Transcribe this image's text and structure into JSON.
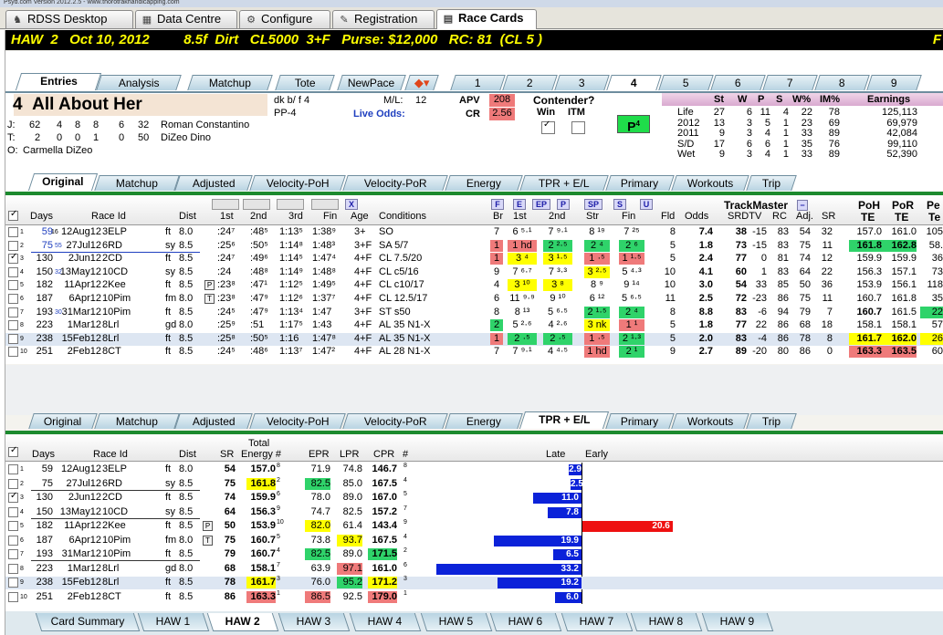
{
  "window": {
    "title_fragment": "Psyd.com   Version 2012.2.5   -   www.thorotrakhandicapping.com"
  },
  "app_tabs": [
    {
      "label": "RDSS Desktop",
      "icon": "horse-icon"
    },
    {
      "label": "Data Centre",
      "icon": "folder-icon"
    },
    {
      "label": "Configure",
      "icon": "gear-icon"
    },
    {
      "label": "Registration",
      "icon": "registration-icon"
    },
    {
      "label": "Race Cards",
      "icon": "racecard-icon"
    }
  ],
  "race_header": {
    "text": "HAW  2   Oct 10, 2012         8.5f  Dirt   CL5000  3+F   Purse: $12,000   RC: 81  (CL 5 )",
    "right": "F"
  },
  "horse_tabs": [
    "Entries",
    "Analysis",
    "Matchup",
    "Tote",
    "NewPace"
  ],
  "post_tabs": [
    "1",
    "2",
    "3",
    "4",
    "5",
    "6",
    "7",
    "8",
    "9"
  ],
  "horse": {
    "post": "4",
    "name": "All About Her",
    "color": "dk b/ f 4",
    "pp": "PP-4",
    "ml_label": "M/L:",
    "ml": "12",
    "live_odds_label": "Live Odds:",
    "apv_label": "APV",
    "apv": "208",
    "cr_label": "CR",
    "cr": "2.56",
    "contender_label": "Contender?",
    "win_label": "Win",
    "itm_label": "ITM",
    "p_badge": "P",
    "p_sup": "4",
    "jockey": {
      "label": "J:",
      "stats": [
        "62",
        "4",
        "8",
        "8",
        "6",
        "32"
      ],
      "name": "Roman Constantino"
    },
    "trainer": {
      "label": "T:",
      "stats": [
        "2",
        "0",
        "0",
        "1",
        "0",
        "50"
      ],
      "name": "DiZeo Dino"
    },
    "owner": {
      "label": "O:",
      "name": "Carmella DiZeo"
    }
  },
  "record": {
    "headers": [
      "St",
      "W",
      "P",
      "S",
      "W%",
      "IM%",
      "Earnings"
    ],
    "rows": [
      {
        "label": "Life",
        "v": [
          "27",
          "6",
          "11",
          "4",
          "22",
          "78",
          "125,113"
        ]
      },
      {
        "label": "2012",
        "v": [
          "13",
          "3",
          "5",
          "1",
          "23",
          "69",
          "69,979"
        ]
      },
      {
        "label": "2011",
        "v": [
          "9",
          "3",
          "4",
          "1",
          "33",
          "89",
          "42,084"
        ]
      },
      {
        "label": "S/D",
        "v": [
          "17",
          "6",
          "6",
          "1",
          "35",
          "76",
          "99,110"
        ]
      },
      {
        "label": "Wet",
        "v": [
          "9",
          "3",
          "4",
          "1",
          "33",
          "89",
          "52,390"
        ]
      }
    ]
  },
  "view_tabs": [
    "Original",
    "Matchup",
    "Adjusted",
    "Velocity-PoH",
    "Velocity-PoR",
    "Energy",
    "TPR + E/L",
    "Primary",
    "Workouts",
    "Trip"
  ],
  "upper_grid": {
    "headers": {
      "days": "Days",
      "raceid": "Race Id",
      "dist": "Dist",
      "c1": "1st",
      "c2": "2nd",
      "c3": "3rd",
      "fin": "Fin",
      "age": "Age",
      "cond": "Conditions",
      "br": "Br",
      "f1": "1st",
      "f2": "2nd",
      "str": "Str",
      "ffin": "Fin",
      "fld": "Fld",
      "odds": "Odds",
      "tm": "TrackMaster",
      "srdtv": "SRDTV",
      "rc": "RC",
      "adj": "Adj.",
      "sr": "SR",
      "poh": "PoH",
      "por": "PoR",
      "pe": "Pe",
      "te": "TE",
      "te2": "TE",
      "te3": "Te"
    },
    "buttons": [
      "F",
      "E",
      "EP",
      "P",
      "SP",
      "S",
      "U",
      "X"
    ],
    "rows": [
      {
        "n": "1",
        "days": "59",
        "dsup": "16",
        "date": "12Aug12",
        "race": "3ELP",
        "track": "ft",
        "dist": "8.0",
        "c1": ":24⁷",
        ":c2": "",
        "c2": ":48⁵",
        "c3": "1:13⁵",
        "fin": "1:38⁹",
        "age": "3+",
        "cond": "SO",
        "br": "7",
        "f1": "6 ⁵·¹",
        "f2": "7 ⁹·¹",
        "str": "8 ¹⁹",
        "ffin": "7 ²⁵",
        "fld": "8",
        "odds": "7.4",
        "srd": "38",
        "tv": "-15",
        "rc": "83",
        "adj": "54",
        "sr": "32",
        "te": "157.0",
        "te2": "161.0",
        "te3": "105"
      },
      {
        "n": "2",
        "days": "75",
        "dsup": "55",
        "date": "27Jul12",
        "race": "6RD",
        "track": "sy",
        "dist": "8.5",
        "c1": ":25⁶",
        "c2": ":50⁵",
        "c3": "1:14⁸",
        "fin": "1:48³",
        "age": "3+F",
        "cond": "SA 5/7",
        "br": "1",
        "f1": "1 hd",
        "f2": "2 ²·⁵",
        "str": "2 ⁴",
        "ffin": "2 ⁶",
        "fld": "5",
        "odds": "1.8",
        "srd": "73",
        "tv": "-15",
        "rc": "83",
        "adj": "75",
        "sr": "11",
        "te": "161.8",
        "te2": "162.8",
        "te3": "58."
      },
      {
        "n": "3",
        "days": "130",
        "dsup": "",
        "date": "2Jun12",
        "race": "2CD",
        "track": "ft",
        "dist": "8.5",
        "c1": ":24⁷",
        "c2": ":49⁶",
        "c3": "1:14⁵",
        "fin": "1:47⁴",
        "age": "4+F",
        "cond": "CL 7.5/20",
        "br": "1",
        "f1": "3 ⁴",
        "f2": "3 ¹·⁵",
        "str": "1 ·⁵",
        "ffin": "1 ¹·⁵",
        "fld": "5",
        "odds": "2.4",
        "srd": "77",
        "tv": "0",
        "rc": "81",
        "adj": "74",
        "sr": "12",
        "te": "159.9",
        "te2": "159.9",
        "te3": "36"
      },
      {
        "n": "4",
        "days": "150",
        "dsup": "32",
        "date": "13May12",
        "race": "10CD",
        "track": "sy",
        "dist": "8.5",
        "c1": ":24",
        "c2": ":48⁸",
        "c3": "1:14⁹",
        "fin": "1:48⁸",
        "age": "4+F",
        "cond": "CL c5/16",
        "br": "9",
        "f1": "7 ⁶·⁷",
        "f2": "7 ³·³",
        "str": "3 ²·⁵",
        "ffin": "5 ⁴·³",
        "fld": "10",
        "odds": "4.1",
        "srd": "60",
        "tv": "1",
        "rc": "83",
        "adj": "64",
        "sr": "22",
        "te": "156.3",
        "te2": "157.1",
        "te3": "73"
      },
      {
        "n": "5",
        "days": "182",
        "dsup": "",
        "date": "11Apr12",
        "race": "2Kee",
        "track": "ft",
        "dist": "8.5",
        "c1": ":23⁸",
        "c2": ":47¹",
        "c3": "1:12⁵",
        "fin": "1:49⁵",
        "age": "4+F",
        "cond": "CL c10/17",
        "br": "4",
        "f1": "3 ¹⁰",
        "f2": "3 ⁸",
        "str": "8 ⁹",
        "ffin": "9 ¹⁴",
        "fld": "10",
        "odds": "3.0",
        "srd": "54",
        "tv": "33",
        "rc": "85",
        "adj": "50",
        "sr": "36",
        "te": "153.9",
        "te2": "156.1",
        "te3": "118"
      },
      {
        "n": "6",
        "days": "187",
        "dsup": "",
        "date": "6Apr12",
        "race": "10Pim",
        "track": "fm",
        "dist": "8.0",
        "c1": ":23⁸",
        "c2": ":47⁹",
        "c3": "1:12⁶",
        "fin": "1:37⁷",
        "age": "4+F",
        "cond": "CL 12.5/17",
        "br": "6",
        "f1": "11 ⁹·⁹",
        "f2": "9 ¹⁰",
        "str": "6 ¹²",
        "ffin": "5 ⁶·⁵",
        "fld": "11",
        "odds": "2.5",
        "srd": "72",
        "tv": "-23",
        "rc": "86",
        "adj": "75",
        "sr": "11",
        "te": "160.7",
        "te2": "161.8",
        "te3": "35"
      },
      {
        "n": "7",
        "days": "193",
        "dsup": "30",
        "date": "31Mar12",
        "race": "10Pim",
        "track": "ft",
        "dist": "8.5",
        "c1": ":24⁵",
        "c2": ":47⁹",
        "c3": "1:13⁴",
        "fin": "1:47",
        "age": "3+F",
        "cond": "ST s50",
        "br": "8",
        "f1": "8 ¹³",
        "f2": "5 ⁶·⁵",
        "str": "2 ¹·⁵",
        "ffin": "2 ⁴",
        "fld": "8",
        "odds": "8.8",
        "srd": "83",
        "tv": "-6",
        "rc": "94",
        "adj": "79",
        "sr": "7",
        "te": "160.7",
        "te2": "161.5",
        "te3": "22"
      },
      {
        "n": "8",
        "days": "223",
        "dsup": "",
        "date": "1Mar12",
        "race": "8Lrl",
        "track": "gd",
        "dist": "8.0",
        "c1": ":25⁹",
        "c2": ":51",
        "c3": "1:17⁵",
        "fin": "1:43",
        "age": "4+F",
        "cond": "AL 35 N1-X",
        "br": "2",
        "f1": "5 ²·⁶",
        "f2": "4 ²·⁶",
        "str": "3 nk",
        "ffin": "1 ¹",
        "fld": "5",
        "odds": "1.8",
        "srd": "77",
        "tv": "22",
        "rc": "86",
        "adj": "68",
        "sr": "18",
        "te": "158.1",
        "te2": "158.1",
        "te3": "57"
      },
      {
        "n": "9",
        "days": "238",
        "dsup": "",
        "date": "15Feb12",
        "race": "8Lrl",
        "track": "ft",
        "dist": "8.5",
        "c1": ":25⁸",
        "c2": ":50⁵",
        "c3": "1:16",
        "fin": "1:47⁸",
        "age": "4+F",
        "cond": "AL 35 N1-X",
        "br": "1",
        "f1": "2 ·⁵",
        "f2": "2 ·⁵",
        "str": "1 ·⁵",
        "ffin": "2 ¹·³",
        "fld": "5",
        "odds": "2.0",
        "srd": "83",
        "tv": "-4",
        "rc": "86",
        "adj": "78",
        "sr": "8",
        "te": "161.7",
        "te2": "162.0",
        "te3": "26"
      },
      {
        "n": "10",
        "days": "251",
        "dsup": "",
        "date": "2Feb12",
        "race": "8CT",
        "track": "ft",
        "dist": "8.5",
        "c1": ":24⁵",
        "c2": ":48⁶",
        "c3": "1:13⁷",
        "fin": "1:47²",
        "age": "4+F",
        "cond": "AL 28 N1-X",
        "br": "7",
        "f1": "7 ⁹·¹",
        "f2": "4 ⁴·⁵",
        "str": "1 hd",
        "ffin": "2 ¹",
        "fld": "9",
        "odds": "2.7",
        "srd": "89",
        "tv": "-20",
        "rc": "80",
        "adj": "86",
        "sr": "0",
        "te": "163.3",
        "te2": "163.5",
        "te3": "60"
      }
    ]
  },
  "lower_grid": {
    "headers": {
      "days": "Days",
      "raceid": "Race Id",
      "dist": "Dist",
      "sr": "SR",
      "total": "Total",
      "energy": "Energy #",
      "epr": "EPR",
      "lpr": "LPR",
      "cpr": "CPR",
      "hash": "#",
      "late": "Late",
      "early": "Early"
    },
    "rows": [
      {
        "n": "1",
        "days": "59",
        "date": "12Aug12",
        "race": "3ELP",
        "track": "ft",
        "dist": "8.0",
        "sr": "54",
        "energy": "157.0",
        "erank": "8",
        "epr": "71.9",
        "lpr": "74.8",
        "cpr": "146.7",
        "crank": "8",
        "late": 2.9,
        "early": 0
      },
      {
        "n": "2",
        "days": "75",
        "date": "27Jul12",
        "race": "6RD",
        "track": "sy",
        "dist": "8.5",
        "sr": "75",
        "energy": "161.8",
        "erank": "2",
        "epr": "82.5",
        "lpr": "85.0",
        "cpr": "167.5",
        "crank": "4",
        "late": 2.5,
        "early": 0
      },
      {
        "n": "3",
        "days": "130",
        "date": "2Jun12",
        "race": "2CD",
        "track": "ft",
        "dist": "8.5",
        "sr": "74",
        "energy": "159.9",
        "erank": "6",
        "epr": "78.0",
        "lpr": "89.0",
        "cpr": "167.0",
        "crank": "5",
        "late": 11.0,
        "early": 0
      },
      {
        "n": "4",
        "days": "150",
        "date": "13May12",
        "race": "10CD",
        "track": "sy",
        "dist": "8.5",
        "sr": "64",
        "energy": "156.3",
        "erank": "9",
        "epr": "74.7",
        "lpr": "82.5",
        "cpr": "157.2",
        "crank": "7",
        "late": 7.8,
        "early": 0
      },
      {
        "n": "5",
        "days": "182",
        "date": "11Apr12",
        "race": "2Kee",
        "track": "ft",
        "dist": "8.5",
        "sr": "50",
        "energy": "153.9",
        "erank": "10",
        "epr": "82.0",
        "lpr": "61.4",
        "cpr": "143.4",
        "crank": "9",
        "late": 0,
        "early": 20.6
      },
      {
        "n": "6",
        "days": "187",
        "date": "6Apr12",
        "race": "10Pim",
        "track": "fm",
        "dist": "8.0",
        "sr": "75",
        "energy": "160.7",
        "erank": "5",
        "epr": "73.8",
        "lpr": "93.7",
        "cpr": "167.5",
        "crank": "4",
        "late": 19.9,
        "early": 0
      },
      {
        "n": "7",
        "days": "193",
        "date": "31Mar12",
        "race": "10Pim",
        "track": "ft",
        "dist": "8.5",
        "sr": "79",
        "energy": "160.7",
        "erank": "4",
        "epr": "82.5",
        "lpr": "89.0",
        "cpr": "171.5",
        "crank": "2",
        "late": 6.5,
        "early": 0
      },
      {
        "n": "8",
        "days": "223",
        "date": "1Mar12",
        "race": "8Lrl",
        "track": "gd",
        "dist": "8.0",
        "sr": "68",
        "energy": "158.1",
        "erank": "7",
        "epr": "63.9",
        "lpr": "97.1",
        "cpr": "161.0",
        "crank": "6",
        "late": 33.2,
        "early": 0
      },
      {
        "n": "9",
        "days": "238",
        "date": "15Feb12",
        "race": "8Lrl",
        "track": "ft",
        "dist": "8.5",
        "sr": "78",
        "energy": "161.7",
        "erank": "3",
        "epr": "76.0",
        "lpr": "95.2",
        "cpr": "171.2",
        "crank": "3",
        "late": 19.2,
        "early": 0
      },
      {
        "n": "10",
        "days": "251",
        "date": "2Feb12",
        "race": "8CT",
        "track": "ft",
        "dist": "8.5",
        "sr": "86",
        "energy": "163.3",
        "erank": "1",
        "epr": "86.5",
        "lpr": "92.5",
        "cpr": "179.0",
        "crank": "1",
        "late": 6.0,
        "early": 0
      }
    ]
  },
  "bottom_tabs": [
    "Card Summary",
    "HAW 1",
    "HAW 2",
    "HAW 3",
    "HAW 4",
    "HAW 5",
    "HAW 6",
    "HAW 7",
    "HAW 8",
    "HAW 9"
  ],
  "colors": {
    "header_bg": "#000000",
    "header_fg": "#ffff00",
    "green_bar": "#1c8a2e",
    "highlight_yellow": "#ffff00",
    "highlight_green": "#2fd36a",
    "highlight_red": "#ef7a7a",
    "late_bar": "#0b22d9",
    "early_bar": "#ee1010"
  }
}
